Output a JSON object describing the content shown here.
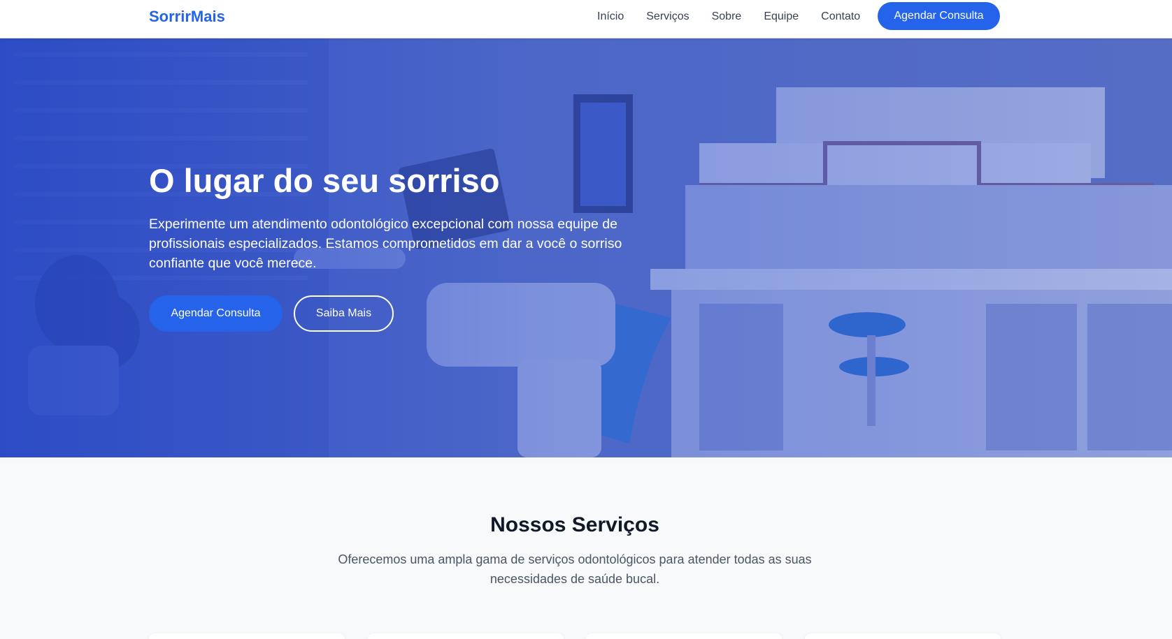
{
  "brand": {
    "name": "SorrirMais",
    "color": "#2563eb"
  },
  "nav": {
    "links": [
      "Início",
      "Serviços",
      "Sobre",
      "Equipe",
      "Contato"
    ],
    "cta_label": "Agendar Consulta"
  },
  "hero": {
    "title": "O lugar do seu sorriso",
    "text": "Experimente um atendimento odontológico excepcional com nossa equipe de profissionais especializados. Estamos comprometidos em dar a você o sorriso confiante que você merece.",
    "primary_button": "Agendar Consulta",
    "secondary_button": "Saiba Mais",
    "background_image": "dental-clinic-photo"
  },
  "services": {
    "title": "Nossos Serviços",
    "subtitle": "Oferecemos uma ampla gama de serviços odontológicos para atender todas as suas necessidades de saúde bucal."
  }
}
